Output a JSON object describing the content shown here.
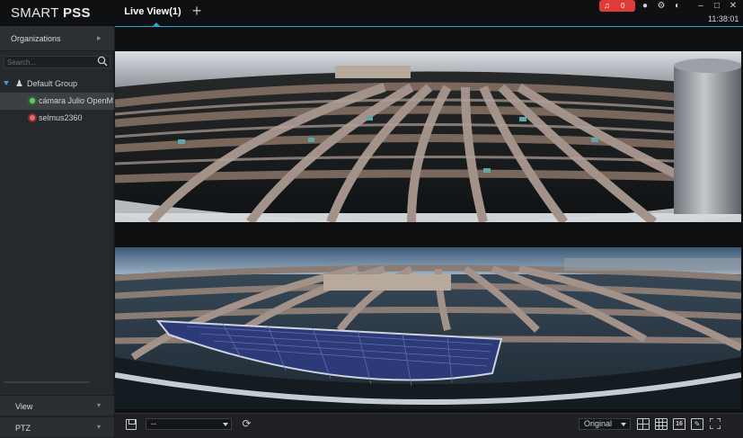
{
  "app": {
    "brand_light": "SMART ",
    "brand_bold": "PSS",
    "tab_label": "Live View(1)",
    "add_tab_glyph": "+",
    "alarm_count": "0",
    "clock": "11:38:01",
    "accent_color": "#29a8d8",
    "alarm_color": "#e03b3b"
  },
  "sidebar": {
    "organizations_label": "Organizations",
    "search_placeholder": "Search...",
    "tree": {
      "group_label": "Default Group",
      "devices": [
        {
          "label": "cámara Julio OpenM",
          "status": "online",
          "icon": "camera-online-icon"
        },
        {
          "label": "selmus2360",
          "status": "offline",
          "icon": "camera-offline-icon"
        }
      ]
    },
    "view_label": "View",
    "ptz_label": "PTZ"
  },
  "toolbar": {
    "view_select_value": "--",
    "scale_select_value": "Original",
    "layout_16_label": "16"
  }
}
